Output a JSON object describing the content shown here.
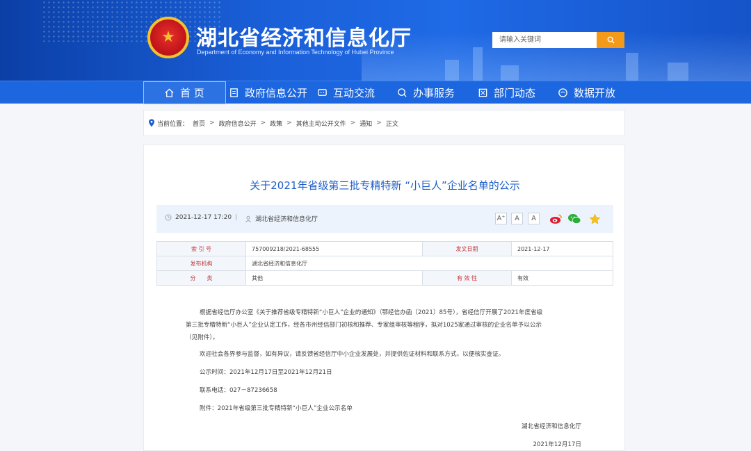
{
  "header": {
    "title": "湖北省经济和信息化厅",
    "subtitle": "Department of Economy and Information Technology of Hubei Province",
    "search_placeholder": "请输入关键词"
  },
  "nav": {
    "items": [
      {
        "label": "首 页",
        "icon": "home-icon"
      },
      {
        "label": "政府信息公开",
        "icon": "document-icon"
      },
      {
        "label": "互动交流",
        "icon": "chat-icon"
      },
      {
        "label": "办事服务",
        "icon": "service-icon"
      },
      {
        "label": "部门动态",
        "icon": "news-icon"
      },
      {
        "label": "数据开放",
        "icon": "data-icon"
      }
    ],
    "active_index": 0
  },
  "breadcrumb": {
    "prefix": "当前位置：",
    "items": [
      "首页",
      "政府信息公开",
      "政策",
      "其他主动公开文件",
      "通知",
      "正文"
    ]
  },
  "article": {
    "title": "关于2021年省级第三批专精特新 “小巨人”企业名单的公示",
    "datetime": "2021-12-17 17:20",
    "source": "湖北省经济和信息化厅",
    "font_buttons": [
      "A⁺",
      "A",
      "A"
    ],
    "info_table": {
      "index_label": "索 引 号",
      "index_value": "757009218/2021-68555",
      "date_label": "发文日期",
      "date_value": "2021-12-17",
      "org_label": "发布机构",
      "org_value": "湖北省经济和信息化厅",
      "category_label": "分　　类",
      "category_value": "其他",
      "validity_label": "有 效 性",
      "validity_value": "有效"
    },
    "paragraphs": [
      "根据省经信厅办公室《关于推荐省级专精特新“小巨人”企业的通知》（鄂经信办函〔2021〕85号），省经信厅开展了2021年度省级",
      "第三批专精特新“小巨人”企业认定工作，经各市州经信部门初核和推荐、专家组审核等程序，拟对1025家通过审核的企业名单予以公示",
      "（见附件）。",
      "欢迎社会各界参与监督，如有异议，请反馈省经信厅中小企业发展处，并提供佐证材料和联系方式，以便核实查证。",
      "公示时间：2021年12月17日至2021年12月21日",
      "联系电话：027－87236658",
      "附件：2021年省级第三批专精特新“小巨人”企业公示名单"
    ],
    "signature": "湖北省经济和信息化厅",
    "sign_date": "2021年12月17日"
  },
  "colors": {
    "brand_blue": "#1c66e0",
    "title_blue": "#1e5fc9",
    "search_orange": "#f49a1b",
    "label_red": "#c63b3b"
  }
}
